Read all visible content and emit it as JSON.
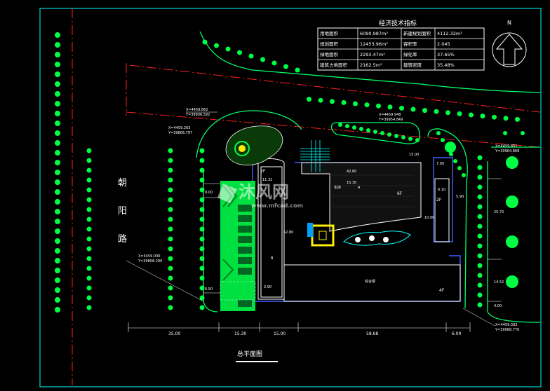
{
  "table": {
    "title": "经济技术指标",
    "rows": [
      [
        "用地面积",
        "6090.987m²",
        "新建规划面积",
        "4112.32m²"
      ],
      [
        "规划面积",
        "12453.96m²",
        "容积率",
        "2.045"
      ],
      [
        "绿地面积",
        "2293.47m²",
        "绿化率",
        "37.65%"
      ],
      [
        "建筑占地面积",
        "2162.5m²",
        "建筑密度",
        "35.48%"
      ]
    ]
  },
  "north": "N",
  "road": [
    "朝",
    "阳",
    "路"
  ],
  "dims_bottom": [
    "35.00",
    "15.30",
    "15.00",
    "58.68",
    "6.00"
  ],
  "dims_left": [
    "9.00",
    "6.50"
  ],
  "dims_right": [
    "25.72",
    "14.52",
    "4.00"
  ],
  "coords": [
    [
      "X=4459.862",
      "Y=39806.592"
    ],
    [
      "X=4459.263",
      "Y=39806.797"
    ],
    [
      "X=4459.948",
      "Y=39954.849"
    ],
    [
      "X=4459.851",
      "Y=39964.868"
    ],
    [
      "X=4459.000",
      "Y=39808.290"
    ],
    [
      "X=4459.392",
      "Y=39968.776"
    ]
  ],
  "bldg": {
    "floors_2f": "2F",
    "floors_6f": "6F",
    "floors_4f": "4F",
    "floors_2f_right": "2F",
    "dim_4260": "42.60",
    "dim_1530": "15.30",
    "dim_1132": "11.32",
    "dim_5280": "52.80",
    "dim_290": "2.90",
    "dim_1500": "15.00",
    "dim_610": "6.10",
    "dim_700": "7.00",
    "dim_1000": "10.00",
    "dim_590": "5.90",
    "parking": "车库",
    "office": "综合楼",
    "label_a": "A",
    "label_b": "B"
  },
  "caption": "总平面图",
  "watermark": {
    "title": "沐风网",
    "url": "www.mfcad.com"
  }
}
